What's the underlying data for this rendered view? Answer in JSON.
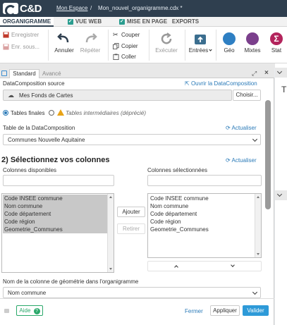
{
  "app": {
    "logo_text": "C&D"
  },
  "breadcrumb": {
    "home": "Mon Espace",
    "sep": "/",
    "doc": "Mon_nouvel_organigramme.cdx *"
  },
  "tabs": [
    {
      "label": "ORGANIGRAMME",
      "check": ""
    },
    {
      "label": "VUE WEB",
      "check": "✓"
    },
    {
      "label": "MISE EN PAGE",
      "check": "✓"
    },
    {
      "label": "EXPORTS",
      "check": ""
    }
  ],
  "ribbon": {
    "save": "Enregistrer",
    "save_as": "Enr. sous...",
    "undo": "Annuler",
    "redo": "Répéter",
    "cut": "Couper",
    "copy": "Copier",
    "paste": "Coller",
    "execute": "Exécuter",
    "inputs": "Entrées",
    "geo": "Géo",
    "mixed": "Mixtes",
    "stat": "Stat"
  },
  "panel": {
    "tab_standard": "Standard",
    "tab_advanced": "Avancé",
    "source_label": "DataComposition source",
    "open_link": "Ouvrir la DataComposition",
    "source_value": "Mes Fonds de Cartes",
    "choose_btn": "Choisir...",
    "radio_final": "Tables finales",
    "radio_intermediate": "Tables intermédiaires (déprécié)",
    "table_label": "Table de la DataComposition",
    "refresh": "Actualiser",
    "table_value": "Communes Nouvelle Aquitaine",
    "step_title": "2) Sélectionnez vos colonnes",
    "available_label": "Colonnes disponibles",
    "selected_label": "Colonnes sélectionnées",
    "available": [
      "Code INSEE commune",
      "Nom commune",
      "Code département",
      "Code région",
      "Geometrie_Communes"
    ],
    "selected": [
      "Code INSEE commune",
      "Nom commune",
      "Code département",
      "Code région",
      "Geometrie_Communes"
    ],
    "add_btn": "Ajouter",
    "remove_btn": "Retirer",
    "geom_label": "Nom de la colonne de géométrie dans l'organigramme",
    "geom_value": "Nom commune",
    "help_btn": "Aide",
    "close_btn": "Fermer",
    "apply_btn": "Appliquer",
    "validate_btn": "Valider"
  },
  "side": {
    "heading": "T"
  },
  "colors": {
    "primary": "#2a7ab8",
    "header": "#2f3f4f",
    "validate": "#2e9ad8",
    "help": "#2aa86a"
  }
}
